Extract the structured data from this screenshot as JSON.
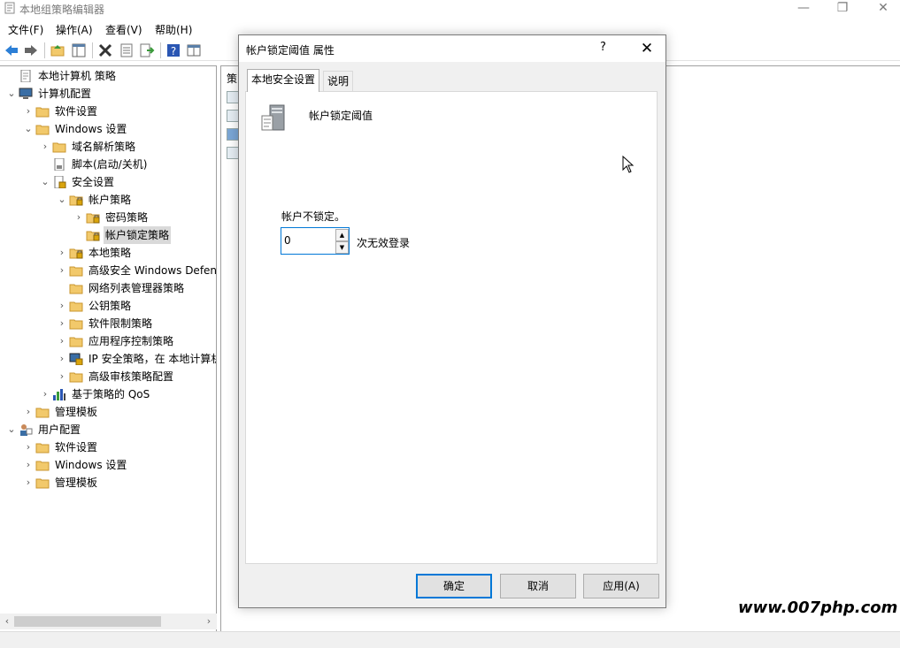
{
  "window": {
    "title": "本地组策略编辑器"
  },
  "menu": [
    "文件(F)",
    "操作(A)",
    "查看(V)",
    "帮助(H)"
  ],
  "tree": [
    {
      "label": "本地计算机 策略",
      "chev": "",
      "level": 0,
      "icon": "policy-doc-icon"
    },
    {
      "label": "计算机配置",
      "chev": "⌄",
      "level": 0,
      "icon": "computer-icon"
    },
    {
      "label": "软件设置",
      "chev": "›",
      "level": 1,
      "icon": "folder-icon"
    },
    {
      "label": "Windows 设置",
      "chev": "⌄",
      "level": 1,
      "icon": "folder-icon"
    },
    {
      "label": "域名解析策略",
      "chev": "›",
      "level": 2,
      "icon": "folder-icon"
    },
    {
      "label": "脚本(启动/关机)",
      "chev": "",
      "level": 2,
      "icon": "script-icon"
    },
    {
      "label": "安全设置",
      "chev": "⌄",
      "level": 2,
      "icon": "security-icon"
    },
    {
      "label": "帐户策略",
      "chev": "⌄",
      "level": 3,
      "icon": "folder-lock-icon"
    },
    {
      "label": "密码策略",
      "chev": "›",
      "level": 4,
      "icon": "folder-lock-icon"
    },
    {
      "label": "帐户锁定策略",
      "chev": "",
      "level": 4,
      "icon": "folder-lock-icon",
      "selected": true
    },
    {
      "label": "本地策略",
      "chev": "›",
      "level": 3,
      "icon": "folder-lock-icon"
    },
    {
      "label": "高级安全 Windows Defen",
      "chev": "›",
      "level": 3,
      "icon": "folder-icon"
    },
    {
      "label": "网络列表管理器策略",
      "chev": "",
      "level": 3,
      "icon": "folder-icon"
    },
    {
      "label": "公钥策略",
      "chev": "›",
      "level": 3,
      "icon": "folder-icon"
    },
    {
      "label": "软件限制策略",
      "chev": "›",
      "level": 3,
      "icon": "folder-icon"
    },
    {
      "label": "应用程序控制策略",
      "chev": "›",
      "level": 3,
      "icon": "folder-icon"
    },
    {
      "label": "IP 安全策略，在 本地计算机",
      "chev": "›",
      "level": 3,
      "icon": "ip-security-icon"
    },
    {
      "label": "高级审核策略配置",
      "chev": "›",
      "level": 3,
      "icon": "folder-icon"
    },
    {
      "label": "基于策略的 QoS",
      "chev": "›",
      "level": 2,
      "icon": "qos-chart-icon"
    },
    {
      "label": "管理模板",
      "chev": "›",
      "level": 1,
      "icon": "folder-icon"
    },
    {
      "label": "用户配置",
      "chev": "⌄",
      "level": 0,
      "icon": "user-icon"
    },
    {
      "label": "软件设置",
      "chev": "›",
      "level": 1,
      "icon": "folder-icon"
    },
    {
      "label": "Windows 设置",
      "chev": "›",
      "level": 1,
      "icon": "folder-icon"
    },
    {
      "label": "管理模板",
      "chev": "›",
      "level": 1,
      "icon": "folder-icon"
    }
  ],
  "right_pane": {
    "header": "策"
  },
  "dialog": {
    "title": "帐户锁定阈值 属性",
    "help": "?",
    "close": "✕",
    "tabs": [
      "本地安全设置",
      "说明"
    ],
    "policy_name": "帐户锁定阈值",
    "lock_label": "帐户不锁定。",
    "value": "0",
    "unit": "次无效登录",
    "buttons": {
      "ok": "确定",
      "cancel": "取消",
      "apply": "应用(A)"
    }
  },
  "watermark": "www.007php.com",
  "colors": {
    "accent": "#0078d7",
    "folder": "#f2c96b",
    "selection": "#d9d9d9"
  }
}
